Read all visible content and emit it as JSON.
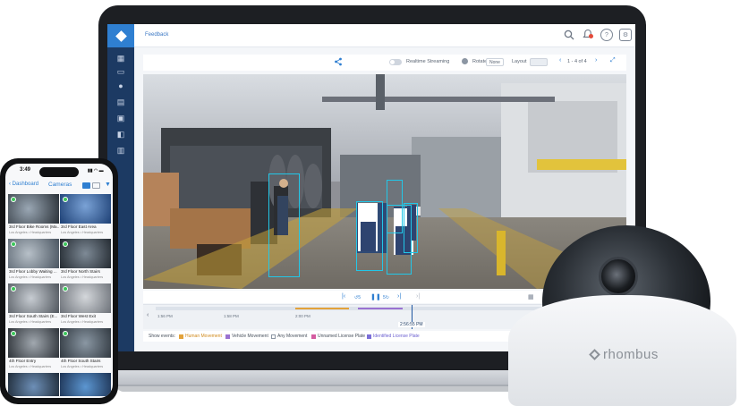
{
  "header": {
    "breadcrumb": "Feedback"
  },
  "toolbar": {
    "realtime_label": "Realtime Streaming",
    "rotate_label": "Rotate",
    "rotate_value": "None",
    "layout_label": "Layout",
    "pagination": "1 - 4 of 4"
  },
  "timeline": {
    "tick_1": "1:56 PM",
    "tick_2": "1:58 PM",
    "tick_3": "2:00 PM",
    "timecode": "2:56:55 PM"
  },
  "events": {
    "label": "Show events:",
    "items": [
      "Human Movement",
      "Vehicle Movement",
      "Any Movement",
      "Unnamed License Plate",
      "Identified License Plate"
    ],
    "colors": [
      "#e3a23a",
      "#9a72d1",
      "#b6c2d1",
      "#d45ba0",
      "#7b6ed8"
    ]
  },
  "phone": {
    "time": "3:49",
    "back_label": "Dashboard",
    "title": "Cameras",
    "cameras": [
      {
        "name": "3rd Floor Bike Rooms (Ma...",
        "location": "Los Angeles • Headquarters"
      },
      {
        "name": "3rd Floor East Area",
        "location": "Los Angeles • Headquarters"
      },
      {
        "name": "3rd Floor Lobby Waiting ...",
        "location": "Los Angeles • Headquarters"
      },
      {
        "name": "3rd Floor North Stairs",
        "location": "Los Angeles • Headquarters"
      },
      {
        "name": "3rd Floor South Stairs (E...",
        "location": "Los Angeles • Headquarters"
      },
      {
        "name": "3rd Floor West Exit",
        "location": "Los Angeles • Headquarters"
      },
      {
        "name": "4th Floor Entry",
        "location": "Los Angeles • Headquarters"
      },
      {
        "name": "4th Floor South Stairs",
        "location": "Los Angeles • Headquarters"
      }
    ]
  },
  "camera": {
    "brand": "rhombus"
  },
  "colors": {
    "brand_blue": "#2f7fd1",
    "sidebar_navy": "#1c3a63",
    "bbox_cyan": "#22c7e8",
    "online_green": "#3cc65a"
  }
}
